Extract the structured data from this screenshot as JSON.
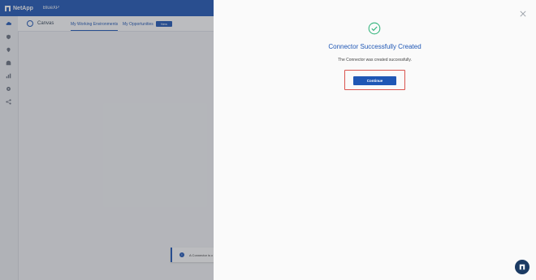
{
  "header": {
    "brand": "NetApp",
    "product": "BlueXP"
  },
  "subbar": {
    "canvas_label": "Canvas",
    "tabs": [
      {
        "label": "My Working Environments"
      },
      {
        "label": "My Opportunities"
      }
    ],
    "badge": "New"
  },
  "nav_icons": [
    "cloud-icon",
    "shield-icon",
    "pin-icon",
    "network-icon",
    "chart-icon",
    "gear-icon",
    "share-icon"
  ],
  "toast": {
    "text": "A Connector is c"
  },
  "dialog": {
    "title": "Connector Successfully Created",
    "message": "The Connector was created successfully.",
    "continue_label": "Continue"
  },
  "colors": {
    "brand": "#1f57b5",
    "success": "#2fb37a",
    "highlight": "#d9544f"
  }
}
